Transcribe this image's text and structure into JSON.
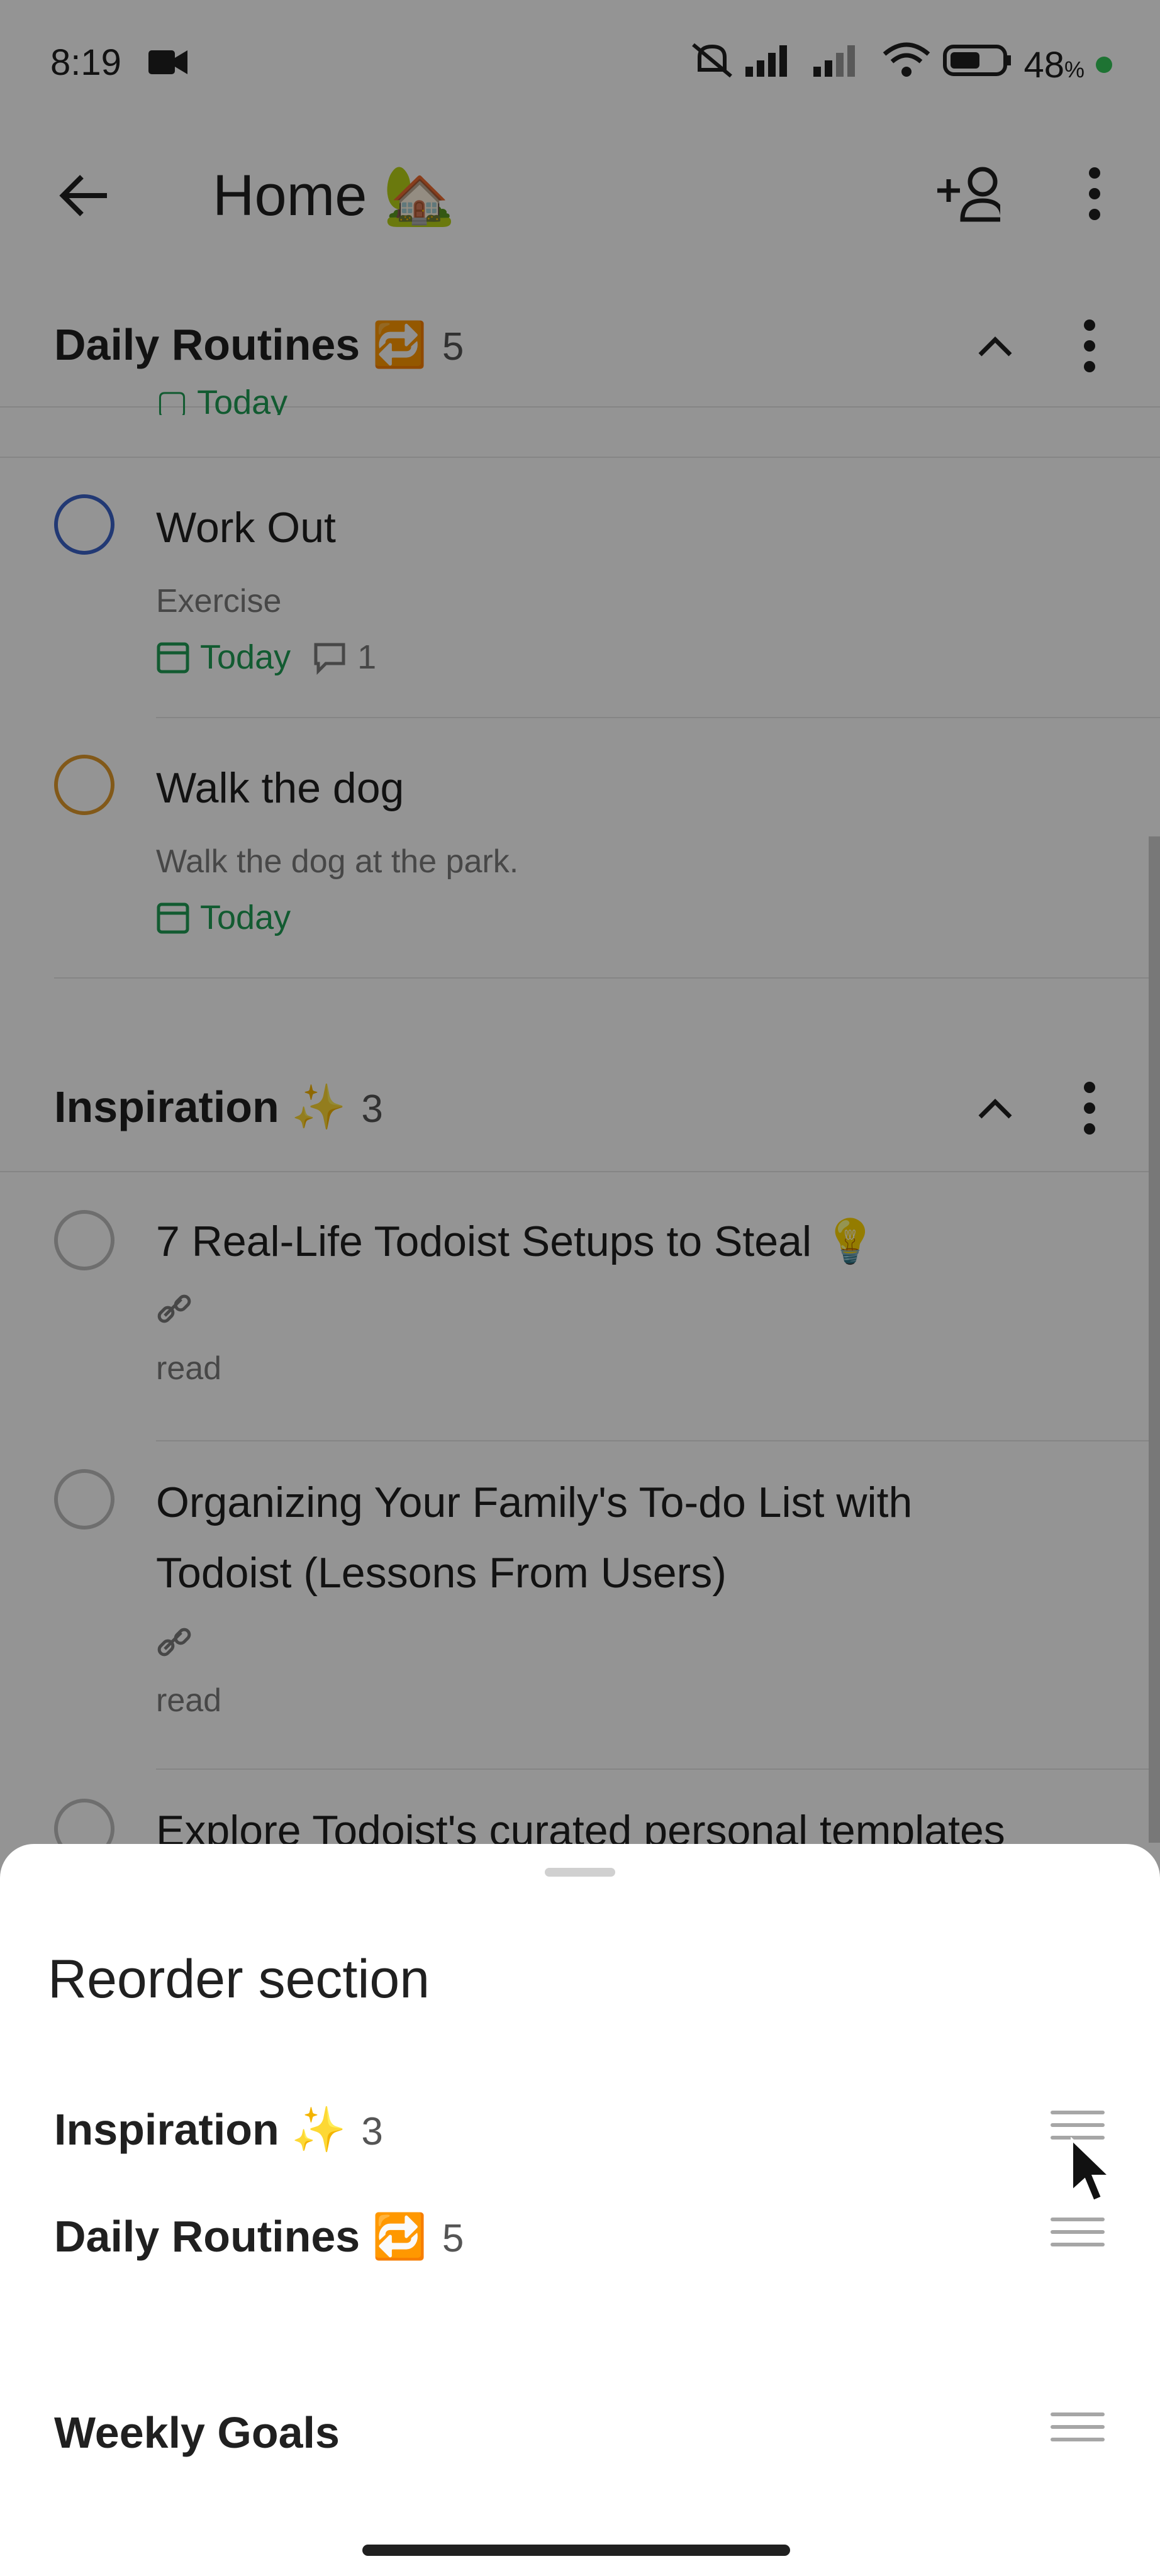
{
  "status_bar": {
    "time": "8:19",
    "battery": "48",
    "battery_unit": "%"
  },
  "header": {
    "title": "Home 🏡"
  },
  "sections": [
    {
      "name": "Daily Routines 🔁",
      "count": "5",
      "tasks": [
        {
          "title": "Work Out",
          "description": "Exercise",
          "date": "Today",
          "comments": "1",
          "circle_color": "#3b62c9"
        },
        {
          "title": "Walk the dog",
          "description": "Walk the dog at the park.",
          "date": "Today",
          "circle_color": "#e09a2b"
        }
      ]
    },
    {
      "name": "Inspiration ✨",
      "count": "3",
      "tasks": [
        {
          "title": "7 Real-Life Todoist Setups to Steal 💡",
          "label": "read"
        },
        {
          "title": "Organizing Your Family's To-do List with",
          "title_line2": "Todoist (Lessons From Users)",
          "label": "read"
        },
        {
          "title": "Explore Todoist's curated personal templates"
        }
      ]
    }
  ],
  "sheet": {
    "title": "Reorder section",
    "items": [
      {
        "name": "Inspiration ✨",
        "count": "3"
      },
      {
        "name": "Daily Routines 🔁",
        "count": "5"
      },
      {
        "name": "Weekly Goals",
        "count": ""
      }
    ]
  },
  "partial_date": "Today",
  "colors": {
    "date_green": "#1f9d55",
    "overlay": "rgba(0,0,0,0.42)"
  }
}
